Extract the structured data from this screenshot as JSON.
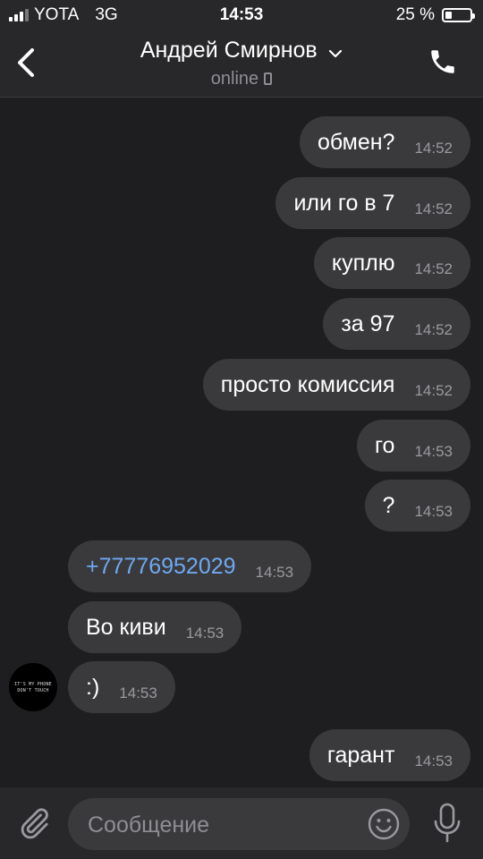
{
  "statusbar": {
    "carrier": "YOTA",
    "network": "3G",
    "time": "14:53",
    "battery_text": "25 %",
    "battery_level": 0.25
  },
  "header": {
    "contact_name": "Андрей Смирнов",
    "status": "online"
  },
  "messages": [
    {
      "dir": "out",
      "text": "обмен?",
      "time": "14:52"
    },
    {
      "dir": "out",
      "text": "или го в 7",
      "time": "14:52"
    },
    {
      "dir": "out",
      "text": "куплю",
      "time": "14:52"
    },
    {
      "dir": "out",
      "text": "за 97",
      "time": "14:52"
    },
    {
      "dir": "out",
      "text": "просто комиссия",
      "time": "14:52"
    },
    {
      "dir": "out",
      "text": "го",
      "time": "14:53"
    },
    {
      "dir": "out",
      "text": "?",
      "time": "14:53"
    },
    {
      "dir": "in",
      "text": "+77776952029",
      "time": "14:53",
      "link": true
    },
    {
      "dir": "in",
      "text": "Во киви",
      "time": "14:53"
    },
    {
      "dir": "in",
      "text": ":)",
      "time": "14:53"
    },
    {
      "dir": "out",
      "text": "гарант",
      "time": "14:53"
    }
  ],
  "avatar": {
    "line1": "IT'S MY PHONE",
    "line2": "DON'T TOUCH"
  },
  "composer": {
    "placeholder": "Сообщение",
    "value": ""
  },
  "colors": {
    "background": "#1e1e20",
    "bar": "#28282a",
    "bubble": "#3a3a3c",
    "link": "#6fa8f2",
    "muted": "#8e8e93"
  },
  "icons": [
    "signal-icon",
    "battery-icon",
    "back-icon",
    "chevron-down-icon",
    "phone-call-icon",
    "paperclip-icon",
    "smile-icon",
    "microphone-icon"
  ]
}
